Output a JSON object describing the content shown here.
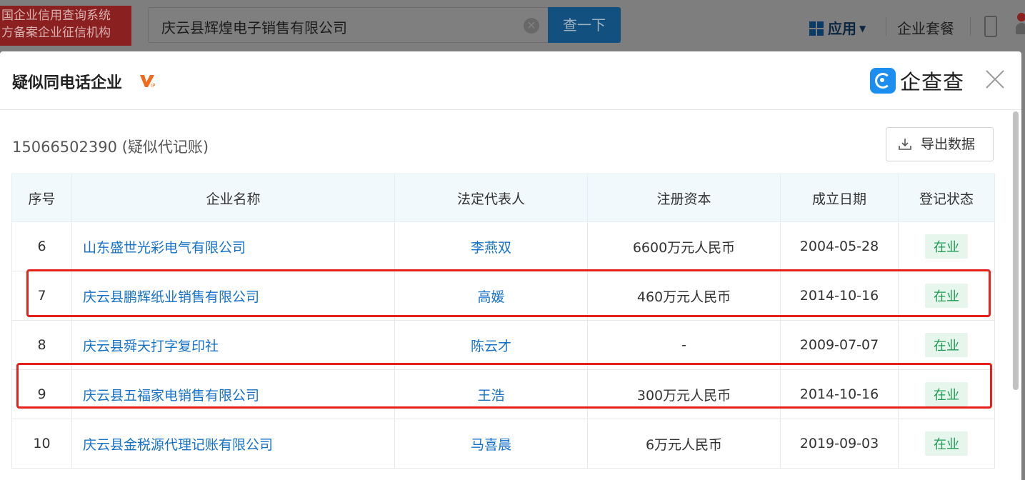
{
  "header": {
    "brand_lines": [
      "国企业信用查询系统",
      "方备案企业征信机构"
    ],
    "search_value": "庆云县辉煌电子销售有限公司",
    "search_button": "查一下",
    "apps_label": "应用",
    "suite_label": "企业套餐"
  },
  "modal": {
    "title": "疑似同电话企业",
    "logo_text": "企查查",
    "phone_info": "15066502390 (疑似代记账)",
    "export_label": "导出数据"
  },
  "table": {
    "columns": [
      "序号",
      "企业名称",
      "法定代表人",
      "注册资本",
      "成立日期",
      "登记状态"
    ],
    "rows": [
      {
        "index": "6",
        "name": "山东盛世光彩电气有限公司",
        "legal_rep": "李燕双",
        "capital": "6600万元人民币",
        "date": "2004-05-28",
        "status": "在业"
      },
      {
        "index": "7",
        "name": "庆云县鹏辉纸业销售有限公司",
        "legal_rep": "高媛",
        "capital": "460万元人民币",
        "date": "2014-10-16",
        "status": "在业"
      },
      {
        "index": "8",
        "name": "庆云县舜天打字复印社",
        "legal_rep": "陈云才",
        "capital": "-",
        "date": "2009-07-07",
        "status": "在业"
      },
      {
        "index": "9",
        "name": "庆云县五福家电销售有限公司",
        "legal_rep": "王浩",
        "capital": "300万元人民币",
        "date": "2014-10-16",
        "status": "在业"
      },
      {
        "index": "10",
        "name": "庆云县金税源代理记账有限公司",
        "legal_rep": "马喜晨",
        "capital": "6万元人民币",
        "date": "2019-09-03",
        "status": "在业"
      }
    ]
  },
  "colors": {
    "link": "#1671c9",
    "highlight": "#e8201a",
    "status_text": "#1f9b55",
    "status_bg": "#e6f6ec"
  }
}
